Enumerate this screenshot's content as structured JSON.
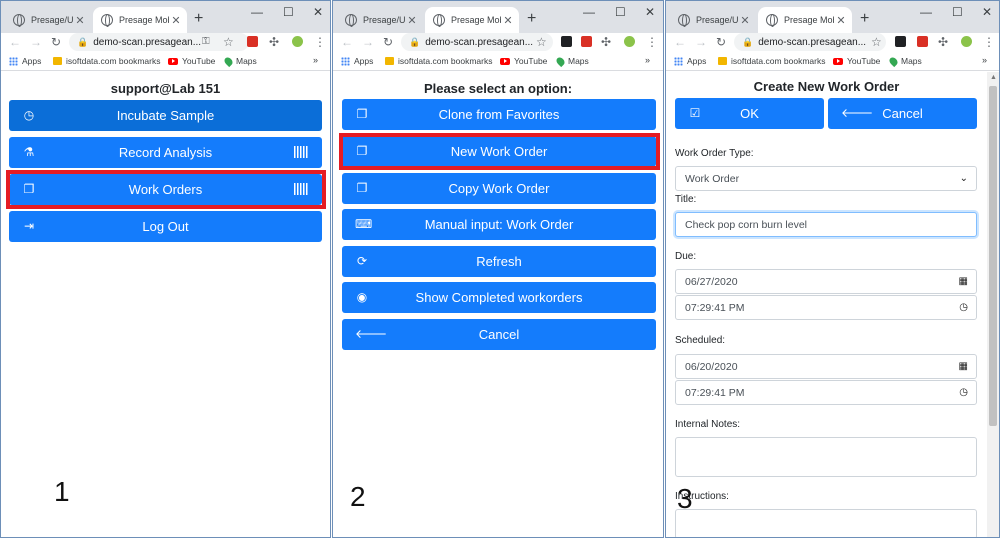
{
  "browser": {
    "tab_inactive": "Presage/User",
    "tab_active": "Presage Mob",
    "new_tab": "+",
    "url": "demo-scan.presagean...",
    "bookmarks": {
      "apps": "Apps",
      "isoft": "isoftdata.com bookmarks",
      "youtube": "YouTube",
      "maps": "Maps",
      "more": "»"
    }
  },
  "panel1": {
    "heading": "support@Lab 151",
    "buttons": [
      "Incubate Sample",
      "Record Analysis",
      "Work Orders",
      "Log Out"
    ],
    "step": "1"
  },
  "panel2": {
    "heading": "Please select an option:",
    "buttons": [
      "Clone from Favorites",
      "New Work Order",
      "Copy Work Order",
      "Manual input: Work Order",
      "Refresh",
      "Show Completed workorders",
      "Cancel"
    ],
    "step": "2"
  },
  "panel3": {
    "heading": "Create New Work Order",
    "ok": "OK",
    "cancel": "Cancel",
    "type_label": "Work Order Type:",
    "type_value": "Work Order",
    "title_label": "Title:",
    "title_value": "Check pop corn burn level",
    "due_label": "Due:",
    "due_date": "06/27/2020",
    "due_time": "07:29:41 PM",
    "scheduled_label": "Scheduled:",
    "scheduled_date": "06/20/2020",
    "scheduled_time": "07:29:41 PM",
    "notes_label": "Internal Notes:",
    "instructions_label": "Instructions:",
    "step": "3"
  },
  "colors": {
    "primary": "#147cfc",
    "highlight": "#e51c23",
    "tabstrip": "#dee1e6"
  }
}
